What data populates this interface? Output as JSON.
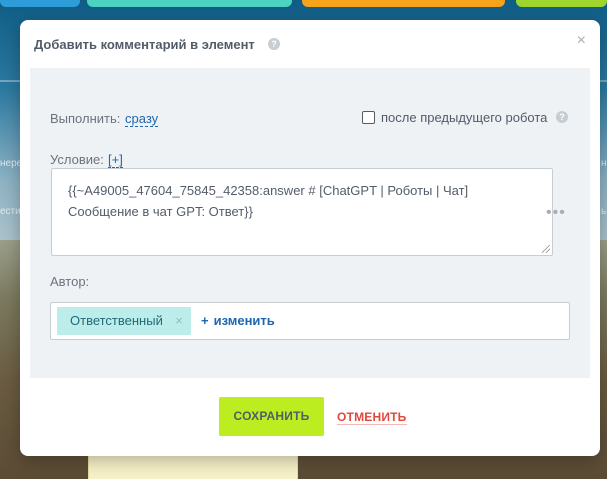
{
  "dialog": {
    "title": "Добавить комментарий в элемент",
    "execute": {
      "label": "Выполнить:",
      "value": "сразу"
    },
    "after_previous": {
      "label": "после предыдущего робота",
      "checked": false
    },
    "condition": {
      "label": "Условие:",
      "value": "[+]"
    },
    "message": "{{~A49005_47604_75845_42358:answer # [ChatGPT | Роботы | Чат] Сообщение в чат GPT: Ответ}}",
    "author": {
      "label": "Автор:",
      "tag": "Ответственный",
      "change_label": "изменить"
    },
    "buttons": {
      "save": "СОХРАНИТЬ",
      "cancel": "ОТМЕНИТЬ"
    }
  },
  "background": {
    "side_left_1": "нере",
    "side_left_2": "ести",
    "side_right_1": "н",
    "side_right_2": "ь"
  },
  "colors": {
    "accent_green": "#bbed21",
    "link_blue": "#2067b0",
    "cancel_red": "#e0473f",
    "tag_bg": "#bcedeb"
  }
}
